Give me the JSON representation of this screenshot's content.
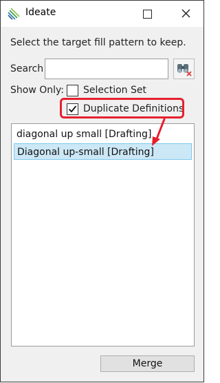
{
  "window": {
    "title": "Ideate",
    "minimize_icon": "square-icon",
    "close_icon": "close-icon"
  },
  "dialog": {
    "prompt": "Select the target fill pattern to keep.",
    "search": {
      "label": "Search",
      "value": "",
      "placeholder": ""
    },
    "find_button_icon": "binoculars-clear-icon",
    "show_only": {
      "label": "Show Only:",
      "options": [
        {
          "label": "Selection Set",
          "checked": false
        },
        {
          "label": "Duplicate Definitions",
          "checked": true
        }
      ]
    },
    "patterns": [
      {
        "label": "diagonal up small [Drafting]",
        "selected": false
      },
      {
        "label": "Diagonal up-small [Drafting]",
        "selected": true
      }
    ],
    "merge_label": "Merge"
  },
  "annotation": {
    "color": "#e5202e"
  },
  "colors": {
    "selection": "#cce8f6",
    "selection_border": "#7ec8ee"
  }
}
